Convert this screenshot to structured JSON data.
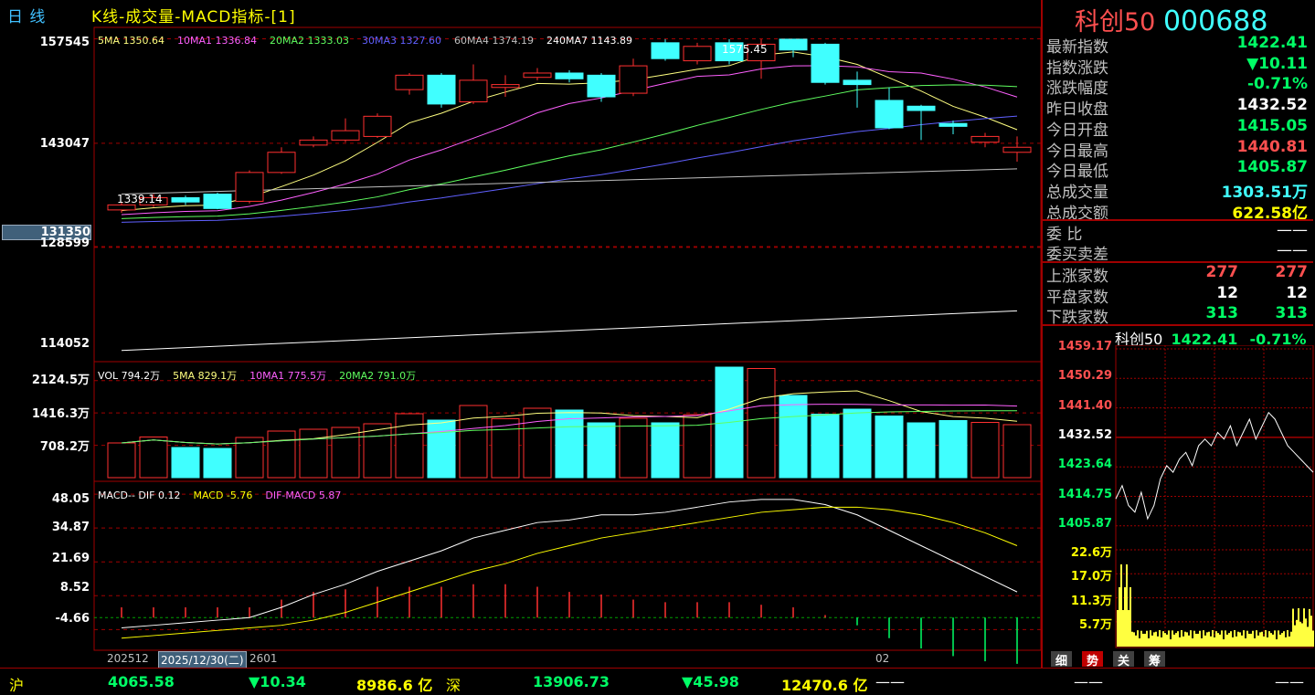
{
  "title": {
    "period": "日  线",
    "indicator": "K线-成交量-MACD指标-[1]"
  },
  "header": {
    "name": "科创50",
    "code": "000688"
  },
  "kline": {
    "yaxis": [
      "157545",
      "143047",
      "131350",
      "128599",
      "114052"
    ],
    "ma_legend": [
      {
        "label": "5MA 1350.64",
        "color": "#ffff80"
      },
      {
        "label": "10MA1 1336.84",
        "color": "#ff60ff"
      },
      {
        "label": "20MA2 1333.03",
        "color": "#60ff60"
      },
      {
        "label": "30MA3 1327.60",
        "color": "#6060ff"
      },
      {
        "label": "60MA4 1374.19",
        "color": "#c0c0c0"
      },
      {
        "label": "240MA7 1143.89",
        "color": "#ffffff"
      }
    ],
    "high_label": "1575.45",
    "low_label": "1339.14",
    "candles": [
      {
        "o": 1338,
        "c": 1345,
        "h": 1348,
        "l": 1334
      },
      {
        "o": 1345,
        "c": 1355,
        "h": 1360,
        "l": 1342
      },
      {
        "o": 1355,
        "c": 1349,
        "h": 1358,
        "l": 1345
      },
      {
        "o": 1360,
        "c": 1340,
        "h": 1362,
        "l": 1339
      },
      {
        "o": 1350,
        "c": 1390,
        "h": 1393,
        "l": 1347
      },
      {
        "o": 1390,
        "c": 1418,
        "h": 1425,
        "l": 1388
      },
      {
        "o": 1428,
        "c": 1435,
        "h": 1440,
        "l": 1425
      },
      {
        "o": 1435,
        "c": 1448,
        "h": 1465,
        "l": 1432
      },
      {
        "o": 1440,
        "c": 1468,
        "h": 1472,
        "l": 1438
      },
      {
        "o": 1505,
        "c": 1525,
        "h": 1528,
        "l": 1498
      },
      {
        "o": 1525,
        "c": 1485,
        "h": 1528,
        "l": 1480
      },
      {
        "o": 1488,
        "c": 1518,
        "h": 1540,
        "l": 1485
      },
      {
        "o": 1508,
        "c": 1512,
        "h": 1525,
        "l": 1495
      },
      {
        "o": 1522,
        "c": 1528,
        "h": 1535,
        "l": 1518
      },
      {
        "o": 1528,
        "c": 1520,
        "h": 1532,
        "l": 1515
      },
      {
        "o": 1525,
        "c": 1495,
        "h": 1528,
        "l": 1488
      },
      {
        "o": 1500,
        "c": 1538,
        "h": 1548,
        "l": 1496
      },
      {
        "o": 1570,
        "c": 1548,
        "h": 1575,
        "l": 1545
      },
      {
        "o": 1545,
        "c": 1565,
        "h": 1570,
        "l": 1540
      },
      {
        "o": 1570,
        "c": 1545,
        "h": 1575,
        "l": 1540
      },
      {
        "o": 1545,
        "c": 1568,
        "h": 1575,
        "l": 1520
      },
      {
        "o": 1575,
        "c": 1560,
        "h": 1575,
        "l": 1550
      },
      {
        "o": 1568,
        "c": 1515,
        "h": 1570,
        "l": 1512
      },
      {
        "o": 1518,
        "c": 1512,
        "h": 1530,
        "l": 1480
      },
      {
        "o": 1490,
        "c": 1452,
        "h": 1508,
        "l": 1450
      },
      {
        "o": 1482,
        "c": 1476,
        "h": 1484,
        "l": 1435
      },
      {
        "o": 1458,
        "c": 1454,
        "h": 1462,
        "l": 1443
      },
      {
        "o": 1432,
        "c": 1440,
        "h": 1445,
        "l": 1425
      },
      {
        "o": 1418,
        "c": 1425,
        "h": 1440,
        "l": 1405
      }
    ]
  },
  "volume": {
    "yaxis": [
      "2124.5万",
      "1416.3万",
      "708.2万"
    ],
    "legend": [
      {
        "label": "VOL 794.2万",
        "color": "#ffffff"
      },
      {
        "label": "5MA 829.1万",
        "color": "#ffff80"
      },
      {
        "label": "10MA1 775.5万",
        "color": "#ff60ff"
      },
      {
        "label": "20MA2 791.0万",
        "color": "#60ff60"
      }
    ],
    "bars": [
      760,
      890,
      660,
      640,
      880,
      1020,
      1060,
      1100,
      1180,
      1400,
      1260,
      1580,
      1290,
      1520,
      1480,
      1200,
      1300,
      1200,
      1380,
      2420,
      2390,
      1800,
      1390,
      1500,
      1350,
      1200,
      1250,
      1210,
      1160
    ]
  },
  "macd": {
    "yaxis": [
      "48.05",
      "34.87",
      "21.69",
      "8.52",
      "-4.66"
    ],
    "legend": [
      {
        "label": "MACD-- DIF 0.12",
        "color": "#ffffff"
      },
      {
        "label": "MACD -5.76",
        "color": "#ffff00"
      },
      {
        "label": "DIF-MACD 5.87",
        "color": "#ff60ff"
      }
    ],
    "dates": [
      "202512",
      "2025/12/30(二)",
      "2601",
      "02"
    ]
  },
  "quote": {
    "rows": [
      {
        "label": "最新指数",
        "value": "1422.41",
        "color": "green"
      },
      {
        "label": "指数涨跌",
        "value": "▼10.11",
        "color": "green"
      },
      {
        "label": "涨跌幅度",
        "value": "-0.71%",
        "color": "green"
      },
      {
        "label": "昨日收盘",
        "value": "1432.52",
        "color": "white"
      },
      {
        "label": "今日开盘",
        "value": "1415.05",
        "color": "green"
      },
      {
        "label": "今日最高",
        "value": "1440.81",
        "color": "red"
      },
      {
        "label": "今日最低",
        "value": "1405.87",
        "color": "green"
      },
      {
        "label": "总成交量",
        "value": "1303.51万",
        "color": "cyan"
      },
      {
        "label": "总成交额",
        "value": "622.58亿",
        "color": "yellow"
      }
    ],
    "commission": [
      {
        "label": "委    比",
        "value": "——"
      },
      {
        "label": "委买卖差",
        "value": "——"
      }
    ],
    "breadth": [
      {
        "label": "上涨家数",
        "v1": "277",
        "v2": "277",
        "color": "red"
      },
      {
        "label": "平盘家数",
        "v1": "12",
        "v2": "12",
        "color": "white"
      },
      {
        "label": "下跌家数",
        "v1": "313",
        "v2": "313",
        "color": "green"
      }
    ]
  },
  "mini": {
    "header_name": "科创50",
    "header_value": "1422.41",
    "header_pct": "-0.71%",
    "price_axis": [
      "1459.17",
      "1450.29",
      "1441.40",
      "1432.52",
      "1423.64",
      "1414.75",
      "1405.87"
    ],
    "vol_axis": [
      "22.6万",
      "17.0万",
      "11.3万",
      "5.7万"
    ],
    "tabs": [
      "细",
      "势",
      "关",
      "筹"
    ]
  },
  "bottom": {
    "sh_label": "沪",
    "sh_index": "4065.58",
    "sh_change": "▼10.34",
    "sh_amount": "8986.6 亿",
    "sz_label": "深",
    "sz_index": "13906.73",
    "sz_change": "▼45.98",
    "sz_amount": "12470.6 亿",
    "dash1": "——",
    "dash2": "——",
    "dash3": "——"
  }
}
